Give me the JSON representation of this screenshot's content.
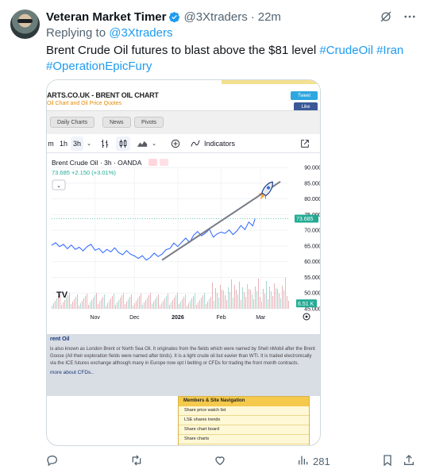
{
  "author": {
    "name": "Veteran Market Timer",
    "handle": "@3Xtraders",
    "time": "22m"
  },
  "reply": {
    "prefix": "Replying to",
    "to": "@3Xtraders"
  },
  "text": {
    "body": "Brent Crude Oil futures to blast above the $81 level ",
    "hashtags": [
      "#CrudeOil",
      "#Iran",
      "#OperationEpicFury"
    ]
  },
  "site": {
    "title": "ARTS.CO.UK - BRENT OIL CHART",
    "subtitle": "Oil Chart and Oil Price Quotes",
    "tweet_btn": "Tweet",
    "like_btn": "Like",
    "tabs": [
      "Daily Charts",
      "News",
      "Pivots"
    ]
  },
  "toolbar": {
    "intervals": [
      "m",
      "1h",
      "3h"
    ],
    "indicators_label": "Indicators"
  },
  "chart_data": {
    "type": "line",
    "title": "Brent Crude Oil · 3h · OANDA",
    "price_line": "73.685 +2.150 (+3.01%)",
    "last_price": "73.685",
    "volume_label": "6.51 K",
    "x_ticks": [
      "Nov",
      "Dec",
      "2026",
      "Feb",
      "Mar"
    ],
    "y_ticks": [
      "90.000",
      "85.000",
      "80.000",
      "75.000",
      "70.000",
      "65.000",
      "60.000",
      "55.000",
      "50.000",
      "45.000"
    ],
    "ylim": [
      45,
      90
    ],
    "x": [
      0,
      5,
      10,
      15,
      20,
      25,
      30,
      35,
      40,
      45,
      50,
      55,
      60,
      65,
      70,
      75,
      80,
      85,
      90,
      95,
      100,
      105,
      110,
      115,
      120,
      125,
      130,
      135,
      140,
      145,
      150,
      155,
      160,
      165,
      170,
      175,
      180,
      185,
      190,
      195,
      200,
      205,
      210,
      215,
      220,
      225,
      230,
      235,
      240,
      245,
      250,
      255,
      258
    ],
    "values": [
      65.2,
      66.0,
      64.8,
      65.5,
      64.1,
      65.3,
      63.9,
      64.6,
      63.4,
      64.8,
      65.5,
      63.6,
      64.2,
      62.8,
      63.9,
      63.1,
      64.4,
      62.9,
      62.2,
      63.5,
      62.4,
      61.8,
      61.0,
      61.9,
      60.5,
      61.3,
      62.7,
      61.6,
      62.4,
      63.8,
      64.2,
      65.9,
      64.8,
      66.2,
      67.5,
      66.1,
      68.4,
      69.6,
      68.2,
      69.1,
      70.3,
      67.8,
      68.9,
      69.4,
      69.0,
      70.1,
      68.6,
      69.8,
      71.5,
      70.2,
      72.6,
      71.4,
      73.685
    ],
    "trendline": {
      "from": [
        140,
        60.5
      ],
      "to": [
        290,
        85.5
      ]
    },
    "annotation": "rocket",
    "colors": {
      "line": "#2962ff",
      "trendline": "#787b86",
      "price_tag": "#22ab94",
      "volume_up": "#e6b3b8",
      "volume_down": "#a9d9cf"
    }
  },
  "info": {
    "title": "rent Oil",
    "body": "is also known as London Brent or North Sea Oil. It originates from the fields which were named by Shell nMobil after the Brent Goose (All their exploration fields were named after birds). It is a light crude oil but eavier than WTI. It is traded electronically via the ICE futures exchange although many in Europe now opt l betting or CFDs for trading the front month contracts.",
    "more": "more about CFDs.."
  },
  "nav": {
    "title": "Members & Site Navigation",
    "items": [
      "Share price watch list",
      "LSE shares trends",
      "Share chart board",
      "Share charts"
    ]
  },
  "actions": {
    "views": "281"
  },
  "icons": [
    "verified-badge-icon",
    "grok-icon",
    "more-icon",
    "reply-icon",
    "retweet-icon",
    "like-icon",
    "views-icon",
    "bookmark-icon",
    "share-icon"
  ]
}
